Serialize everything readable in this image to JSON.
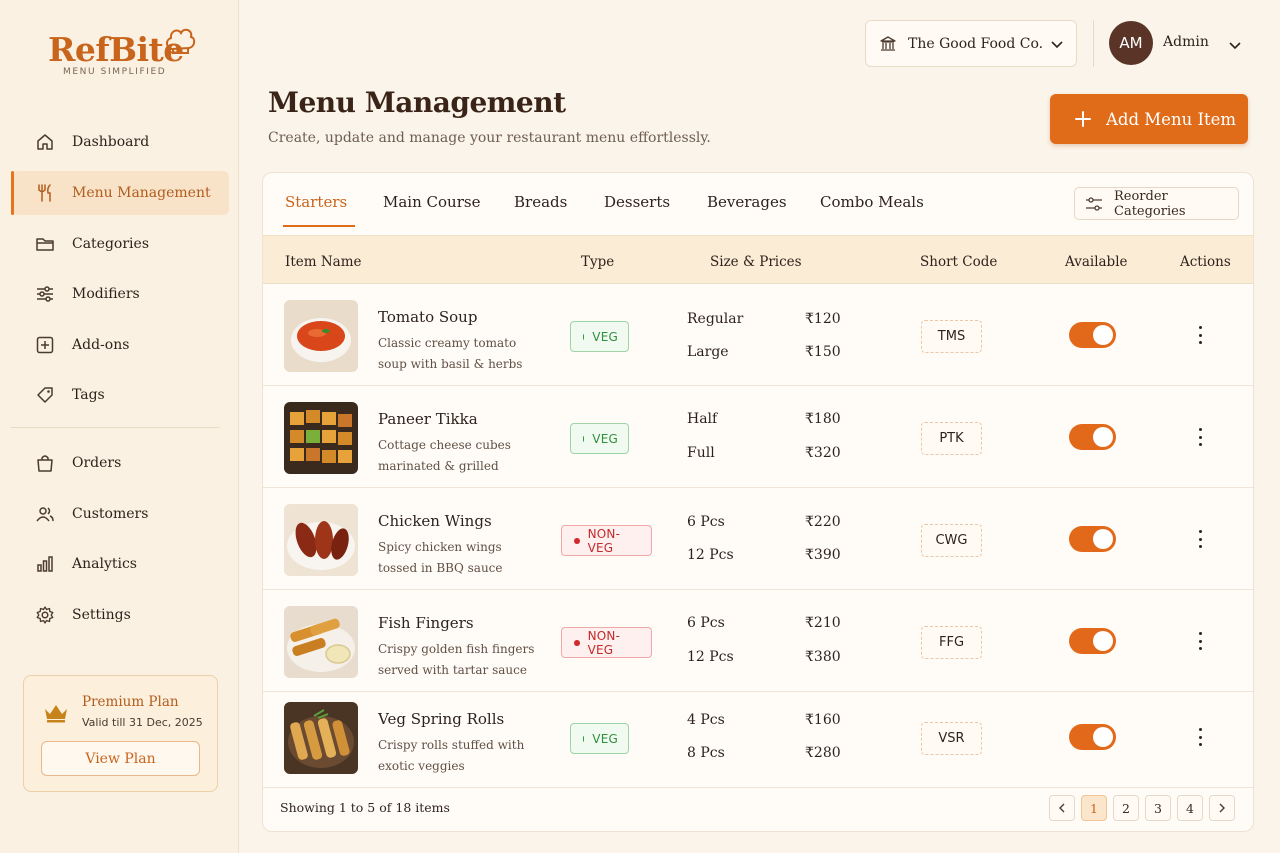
{
  "brand": {
    "name": "RefBite",
    "tagline": "MENU SIMPLIFIED"
  },
  "sidebar": {
    "items": [
      {
        "label": "Dashboard",
        "icon": "home-icon"
      },
      {
        "label": "Menu Management",
        "icon": "fork-knife-icon",
        "active": true
      },
      {
        "label": "Categories",
        "icon": "folder-icon"
      },
      {
        "label": "Modifiers",
        "icon": "sliders-icon"
      },
      {
        "label": "Add-ons",
        "icon": "plus-square-icon"
      },
      {
        "label": "Tags",
        "icon": "tag-icon"
      },
      {
        "label": "Orders",
        "icon": "bag-icon"
      },
      {
        "label": "Customers",
        "icon": "users-icon"
      },
      {
        "label": "Analytics",
        "icon": "bar-chart-icon"
      },
      {
        "label": "Settings",
        "icon": "gear-icon"
      }
    ],
    "plan": {
      "title": "Premium Plan",
      "valid": "Valid till 31 Dec, 2025",
      "button": "View Plan"
    }
  },
  "topbar": {
    "org": "The Good Food Co.",
    "avatar_initials": "AM",
    "user": "Admin"
  },
  "header": {
    "title": "Menu Management",
    "subtitle": "Create, update and manage your restaurant menu effortlessly.",
    "add_button": "Add Menu Item"
  },
  "tabs": [
    "Starters",
    "Main Course",
    "Breads",
    "Desserts",
    "Beverages",
    "Combo Meals"
  ],
  "active_tab": "Starters",
  "reorder_label": "Reorder Categories",
  "table": {
    "columns": [
      "Item Name",
      "Type",
      "Size & Prices",
      "Short Code",
      "Available",
      "Actions"
    ],
    "rows": [
      {
        "name": "Tomato Soup",
        "desc": "Classic creamy tomato soup with basil & herbs",
        "type": "VEG",
        "sizes": [
          {
            "size": "Regular",
            "price": "₹120"
          },
          {
            "size": "Large",
            "price": "₹150"
          }
        ],
        "code": "TMS",
        "available": true
      },
      {
        "name": "Paneer Tikka",
        "desc": "Cottage cheese cubes marinated & grilled",
        "type": "VEG",
        "sizes": [
          {
            "size": "Half",
            "price": "₹180"
          },
          {
            "size": "Full",
            "price": "₹320"
          }
        ],
        "code": "PTK",
        "available": true
      },
      {
        "name": "Chicken Wings",
        "desc": "Spicy chicken wings tossed in BBQ sauce",
        "type": "NON-VEG",
        "sizes": [
          {
            "size": "6 Pcs",
            "price": "₹220"
          },
          {
            "size": "12 Pcs",
            "price": "₹390"
          }
        ],
        "code": "CWG",
        "available": true
      },
      {
        "name": "Fish Fingers",
        "desc": "Crispy golden fish fingers served with tartar sauce",
        "type": "NON-VEG",
        "sizes": [
          {
            "size": "6 Pcs",
            "price": "₹210"
          },
          {
            "size": "12 Pcs",
            "price": "₹380"
          }
        ],
        "code": "FFG",
        "available": true
      },
      {
        "name": "Veg Spring Rolls",
        "desc": "Crispy rolls stuffed with exotic veggies",
        "type": "VEG",
        "sizes": [
          {
            "size": "4 Pcs",
            "price": "₹160"
          },
          {
            "size": "8 Pcs",
            "price": "₹280"
          }
        ],
        "code": "VSR",
        "available": true
      }
    ]
  },
  "footer": {
    "showing": "Showing 1 to 5 of 18 items",
    "pages": [
      "1",
      "2",
      "3",
      "4"
    ],
    "current_page": "1"
  },
  "colors": {
    "accent": "#e06c1a",
    "veg": "#2f8f3b",
    "nonveg": "#c42a2a",
    "brand": "#c8641c"
  }
}
